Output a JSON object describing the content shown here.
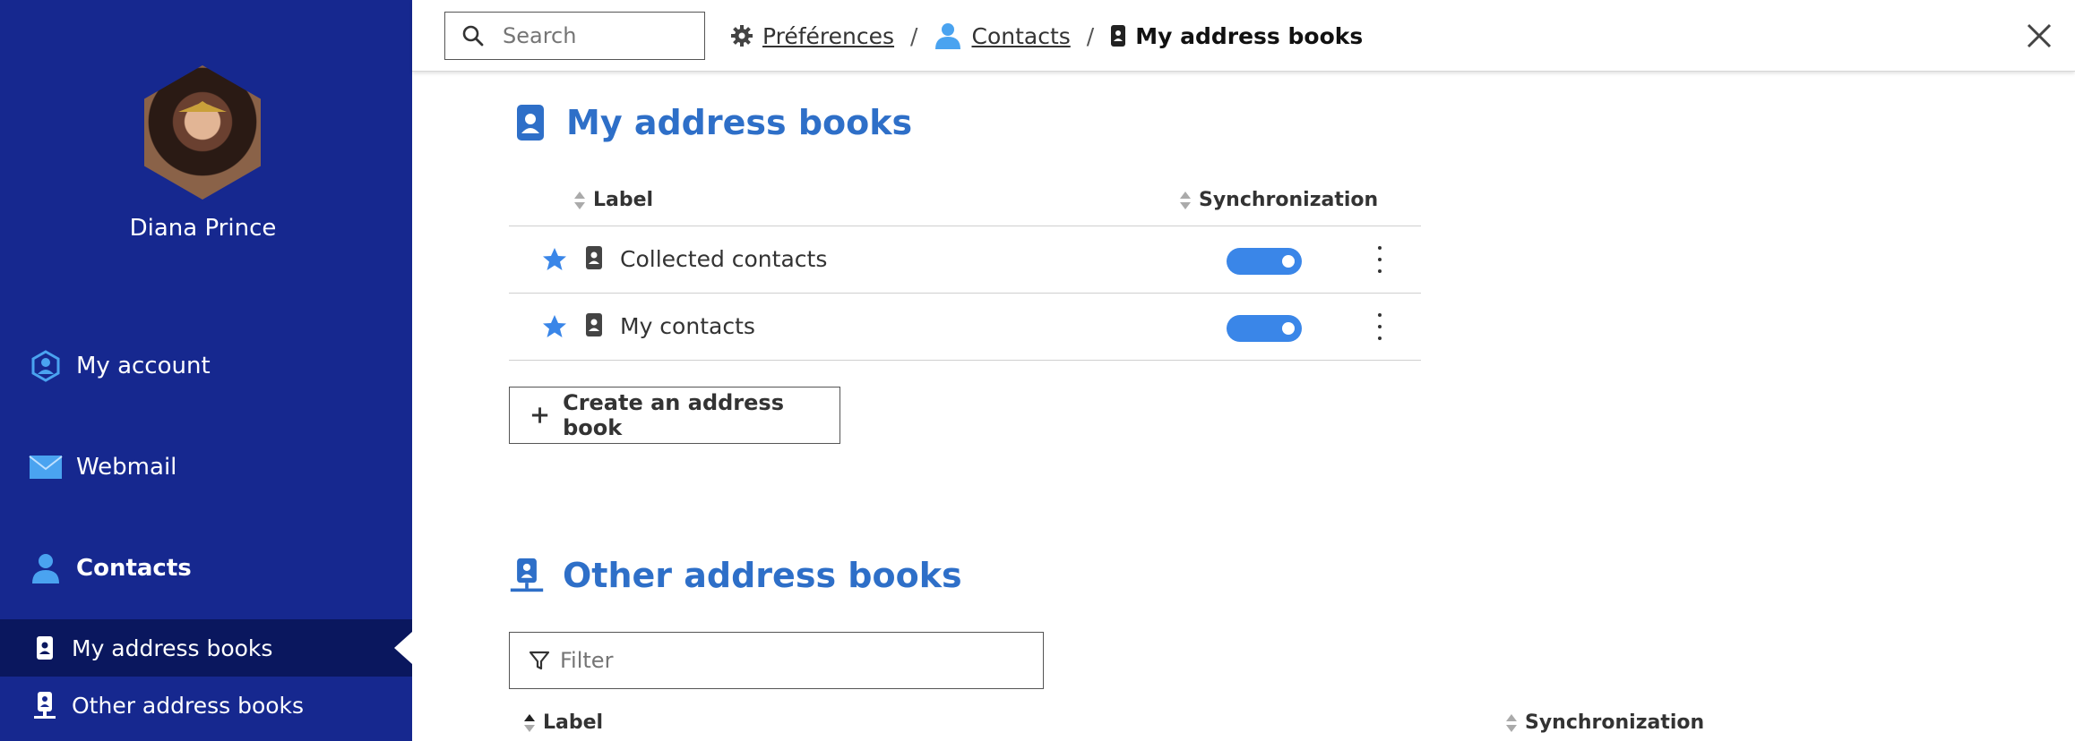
{
  "sidebar": {
    "user_name": "Diana Prince",
    "nav": [
      {
        "label": "My account",
        "icon": "account-icon"
      },
      {
        "label": "Webmail",
        "icon": "envelope-icon"
      },
      {
        "label": "Contacts",
        "icon": "person-icon"
      }
    ],
    "sub_nav": [
      {
        "label": "My address books",
        "icon": "address-book-icon",
        "active": true
      },
      {
        "label": "Other address books",
        "icon": "shared-address-book-icon",
        "active": false
      }
    ]
  },
  "topbar": {
    "search_placeholder": "Search",
    "breadcrumb": [
      {
        "label": "Préférences",
        "icon": "gear-icon"
      },
      {
        "label": "Contacts",
        "icon": "person-icon"
      },
      {
        "label": "My address books",
        "icon": "address-book-icon"
      }
    ],
    "separator": "/"
  },
  "my_books": {
    "title": "My address books",
    "col_label": "Label",
    "col_sync": "Synchronization",
    "rows": [
      {
        "name": "Collected contacts",
        "favorite": true,
        "sync": true
      },
      {
        "name": "My contacts",
        "favorite": true,
        "sync": true
      }
    ],
    "create_label": "Create an address book"
  },
  "other_books": {
    "title": "Other address books",
    "filter_placeholder": "Filter",
    "col_label": "Label",
    "col_sync": "Synchronization"
  },
  "colors": {
    "sidebar_bg": "#16288f",
    "sidebar_active": "#0a175e",
    "accent": "#2e6fc8",
    "toggle_on": "#3a86e8"
  }
}
